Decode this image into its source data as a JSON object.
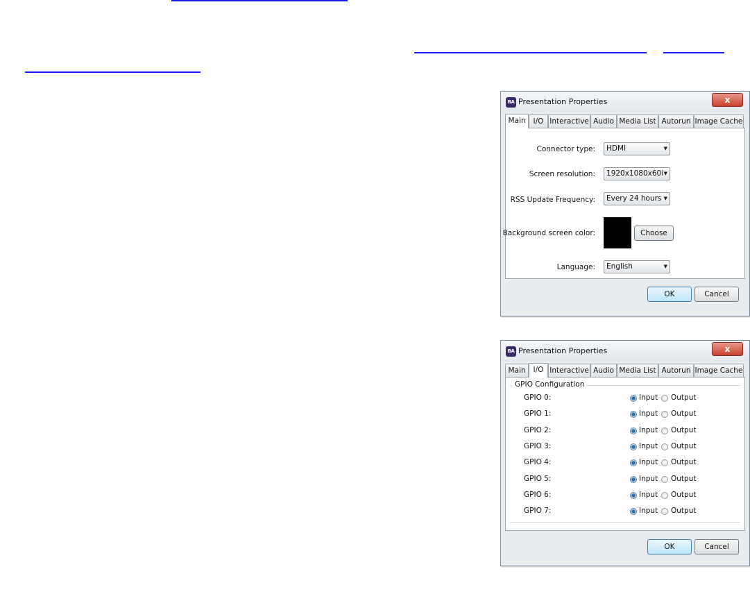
{
  "dialogs": [
    {
      "title": "Presentation Properties",
      "app_icon": "BA",
      "close_glyph": "x",
      "tabs": [
        "Main",
        "I/O",
        "Interactive",
        "Audio",
        "Media List",
        "Autorun",
        "Image Cache"
      ],
      "active_tab": "Main",
      "fields": {
        "connector_type": {
          "label": "Connector type:",
          "value": "HDMI"
        },
        "screen_resolution": {
          "label": "Screen resolution:",
          "value": "1920x1080x60i"
        },
        "rss_update": {
          "label": "RSS Update Frequency:",
          "value": "Every 24 hours"
        },
        "background_color": {
          "label": "Background screen color:",
          "color": "#000000",
          "button": "Choose"
        },
        "language": {
          "label": "Language:",
          "value": "English"
        }
      },
      "ok": "OK",
      "cancel": "Cancel"
    },
    {
      "title": "Presentation Properties",
      "app_icon": "BA",
      "close_glyph": "x",
      "tabs": [
        "Main",
        "I/O",
        "Interactive",
        "Audio",
        "Media List",
        "Autorun",
        "Image Cache"
      ],
      "active_tab": "I/O",
      "group_title": "GPIO Configuration",
      "input_label": "Input",
      "output_label": "Output",
      "gpio": [
        {
          "label": "GPIO 0:",
          "selected": "Input"
        },
        {
          "label": "GPIO 1:",
          "selected": "Input"
        },
        {
          "label": "GPIO 2:",
          "selected": "Input"
        },
        {
          "label": "GPIO 3:",
          "selected": "Input"
        },
        {
          "label": "GPIO 4:",
          "selected": "Input"
        },
        {
          "label": "GPIO 5:",
          "selected": "Input"
        },
        {
          "label": "GPIO 6:",
          "selected": "Input"
        },
        {
          "label": "GPIO 7:",
          "selected": "Input"
        }
      ],
      "ok": "OK",
      "cancel": "Cancel"
    }
  ]
}
